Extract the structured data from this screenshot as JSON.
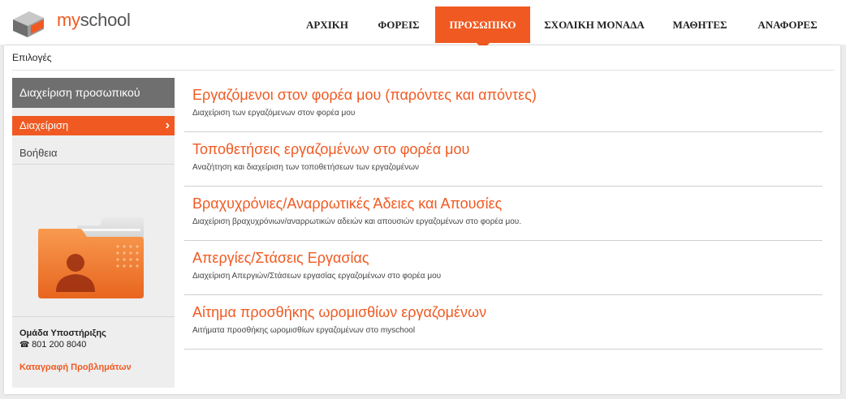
{
  "app": {
    "logo_text": "myschool",
    "brand_color": "#f05a22"
  },
  "nav": {
    "items": [
      {
        "label": "ΑΡΧΙΚΗ",
        "active": false
      },
      {
        "label": "ΦΟΡΕΙΣ",
        "active": false
      },
      {
        "label": "ΠΡΟΣΩΠΙΚΟ",
        "active": true
      },
      {
        "label": "ΣΧΟΛΙΚΗ ΜΟΝΑΔΑ",
        "active": false
      },
      {
        "label": "ΜΑΘΗΤΕΣ",
        "active": false
      },
      {
        "label": "ΑΝΑΦΟΡΕΣ",
        "active": false
      }
    ]
  },
  "breadcrumb": "Επιλογές",
  "sidebar": {
    "title": "Διαχείριση προσωπικού",
    "active_item": "Διαχείριση",
    "help_item": "Βοήθεια",
    "illustration_icon": "personnel-folder-icon",
    "support": {
      "title": "Ομάδα Υποστήριξης",
      "phone": "801 200 8040",
      "report_link": "Καταγραφή Προβλημάτων"
    }
  },
  "content": {
    "items": [
      {
        "title": "Εργαζόμενοι στον φορέα μου (παρόντες και απόντες)",
        "description": "Διαχείριση των εργαζόμενων στον φορέα μου"
      },
      {
        "title": "Τοποθετήσεις εργαζομένων στο φορέα μου",
        "description": "Αναζήτηση και διαχείριση των τοποθετήσεων των εργαζομένων"
      },
      {
        "title": "Βραχυχρόνιες/Αναρρωτικές Άδειες και Απουσίες",
        "description": "Διαχείριση βραχυχρόνιων/αναρρωτικών αδειών και απουσιών εργαζομένων στο φορέα μου."
      },
      {
        "title": "Απεργίες/Στάσεις Εργασίας",
        "description": "Διαχείριση Απεργιών/Στάσεων εργασίας εργαζομένων στο φορέα μου"
      },
      {
        "title": "Αίτημα προσθήκης ωρομισθίων εργαζομένων",
        "description": "Αιτήματα προσθήκης ωρομισθίων εργαζομένων στο myschool"
      }
    ]
  }
}
